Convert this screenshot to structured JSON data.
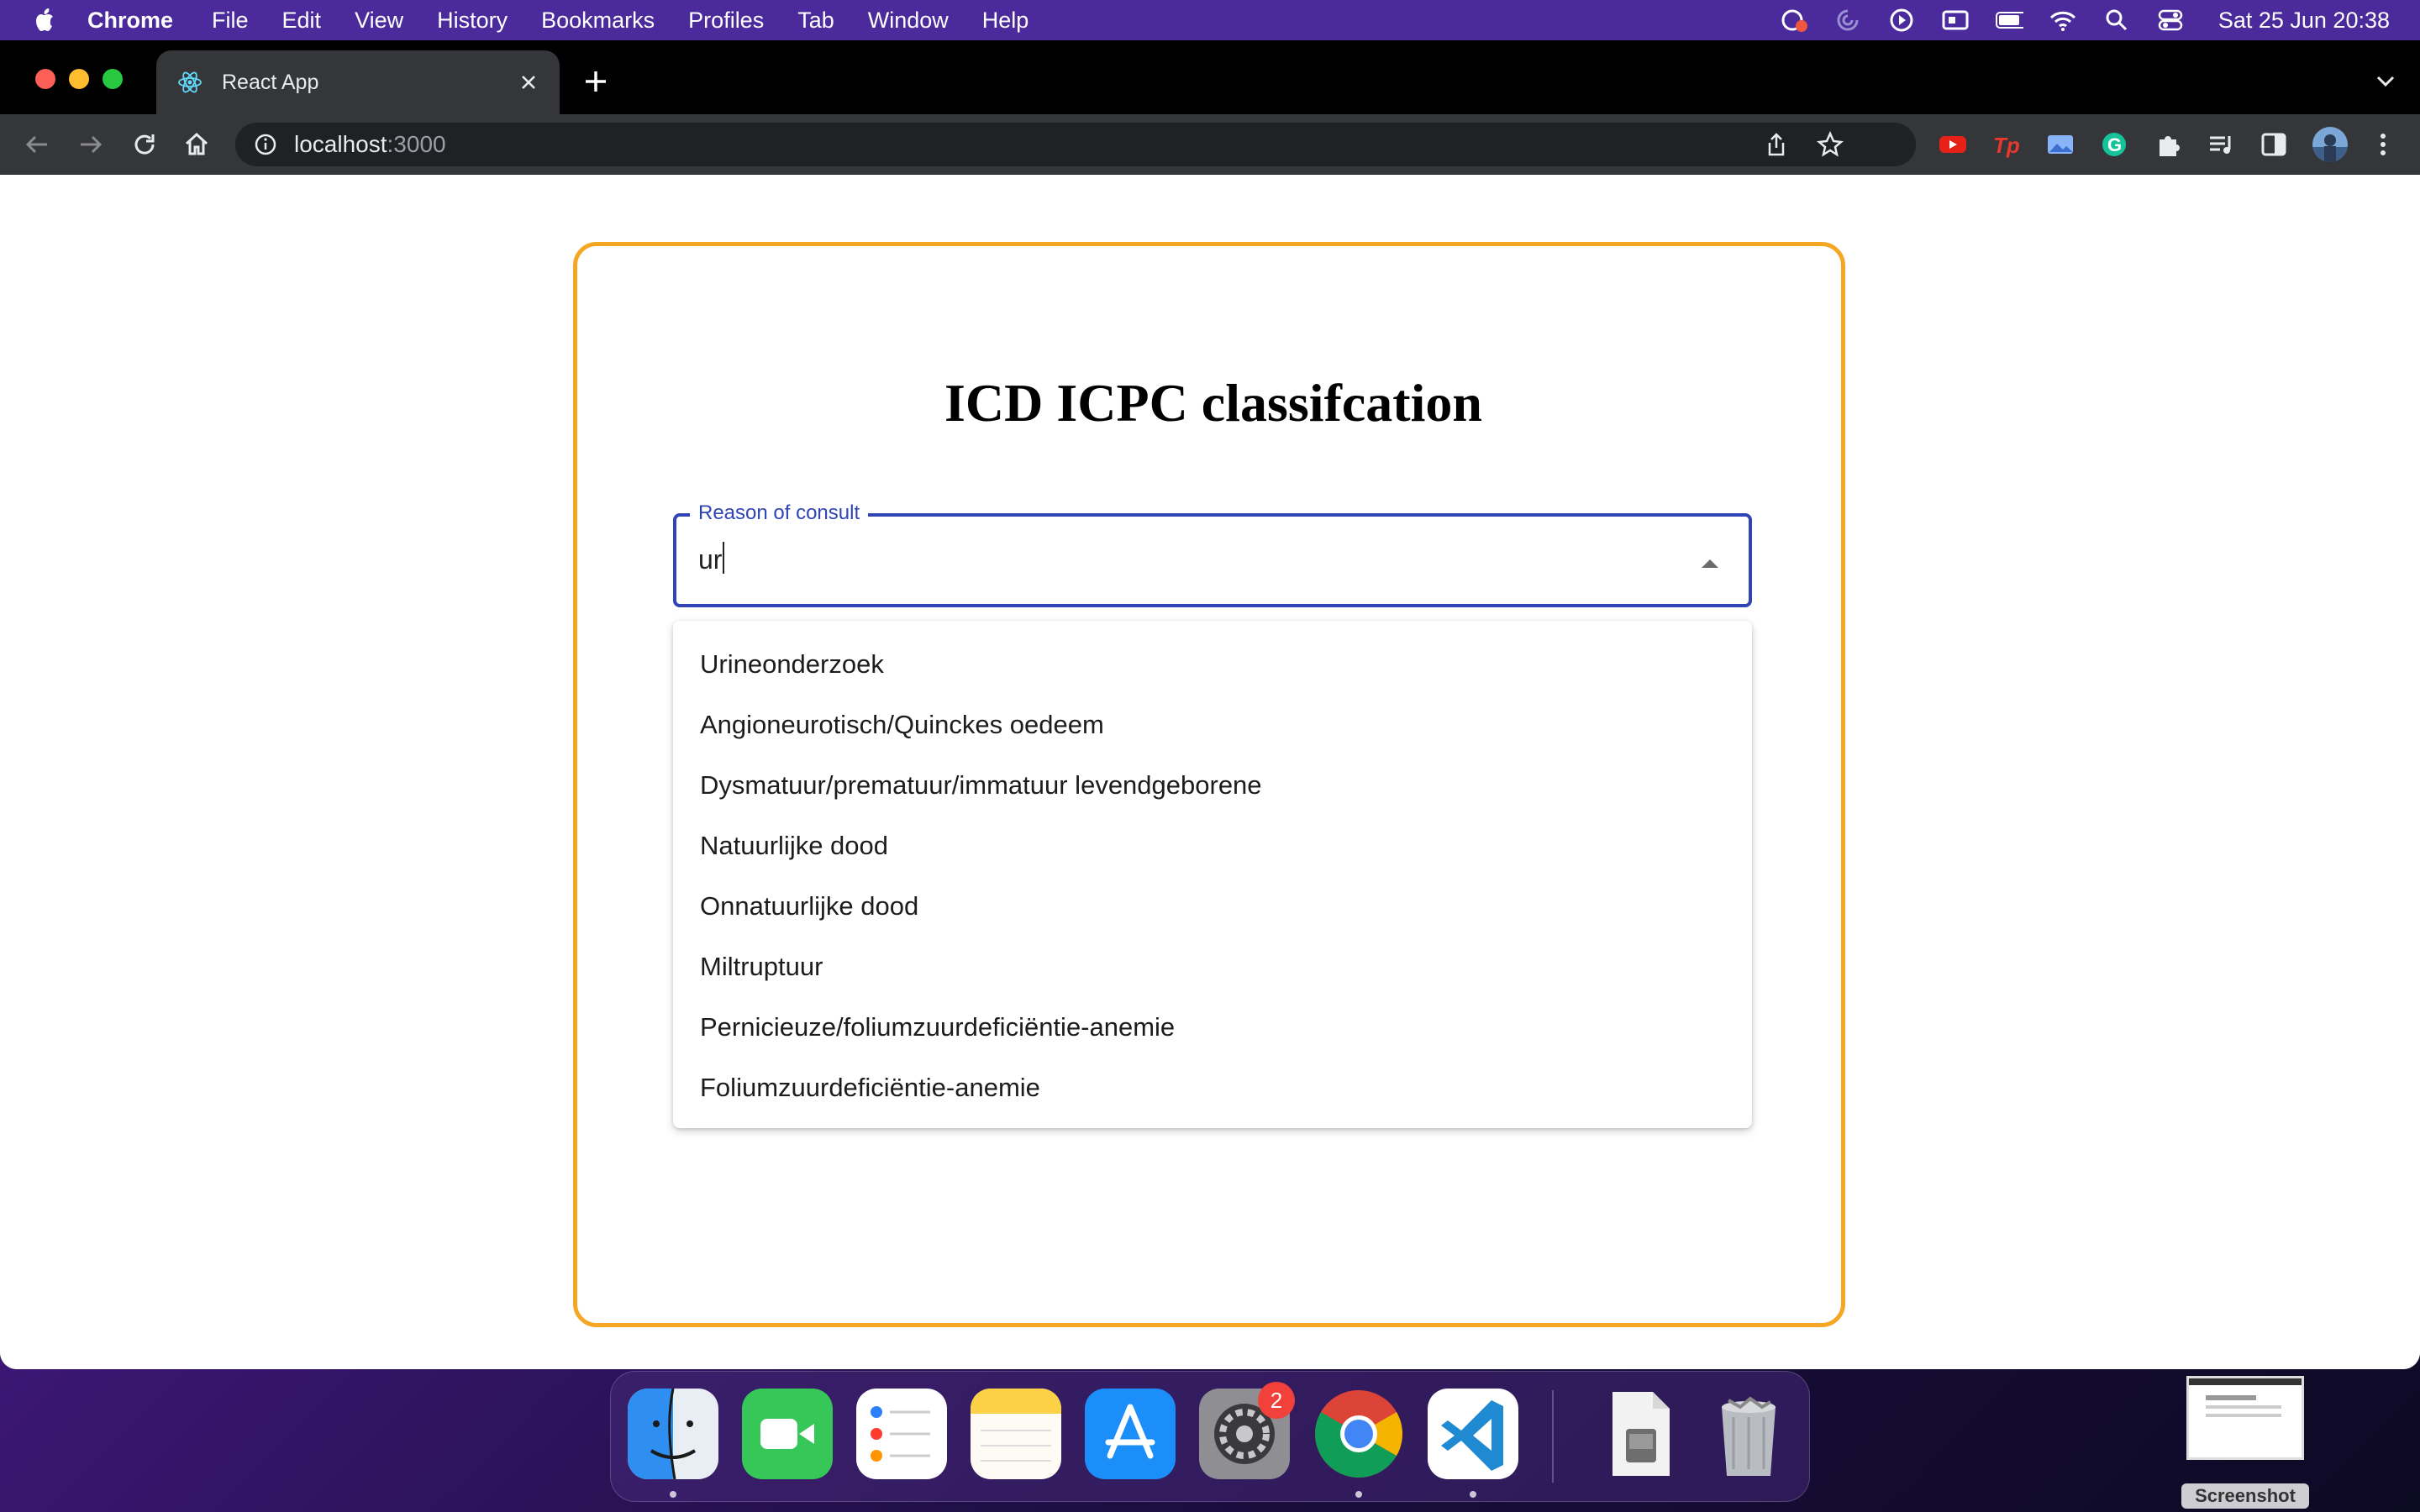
{
  "menubar": {
    "app_name": "Chrome",
    "items": [
      "File",
      "Edit",
      "View",
      "History",
      "Bookmarks",
      "Profiles",
      "Tab",
      "Window",
      "Help"
    ],
    "clock": "Sat 25 Jun  20:38"
  },
  "browser": {
    "tab_title": "React App",
    "url_host": "localhost",
    "url_port": ":3000"
  },
  "page": {
    "heading": "ICD ICPC classifcation",
    "field": {
      "label": "Reason of consult",
      "value": "ur"
    },
    "options": [
      "Urineonderzoek",
      "Angioneurotisch/Quinckes oedeem",
      "Dysmatuur/prematuur/immatuur levendgeborene",
      "Natuurlijke dood",
      "Onnatuurlijke dood",
      "Miltruptuur",
      "Pernicieuze/foliumzuurdeficiëntie-anemie",
      "Foliumzuurdeficiëntie-anemie"
    ]
  },
  "dock": {
    "settings_badge": "2",
    "screenshot_label": "Screenshot"
  },
  "colors": {
    "card_border": "#f5a623",
    "field_accent": "#3045b5"
  }
}
